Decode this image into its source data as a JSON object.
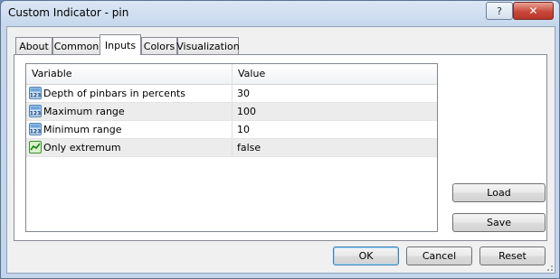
{
  "window": {
    "title": "Custom Indicator - pin",
    "help_label": "?",
    "close_label": "✕"
  },
  "tabs": [
    {
      "label": "About"
    },
    {
      "label": "Common"
    },
    {
      "label": "Inputs",
      "active": true
    },
    {
      "label": "Colors"
    },
    {
      "label": "Visualization"
    }
  ],
  "grid": {
    "headers": {
      "variable": "Variable",
      "value": "Value"
    },
    "rows": [
      {
        "icon": "numeric-123-icon",
        "variable": "Depth of pinbars in percents",
        "value": "30"
      },
      {
        "icon": "numeric-123-icon",
        "variable": "Maximum range",
        "value": "100"
      },
      {
        "icon": "numeric-123-icon",
        "variable": "Minimum range",
        "value": "10"
      },
      {
        "icon": "boolean-chart-icon",
        "variable": "Only extremum",
        "value": "false"
      }
    ]
  },
  "side_buttons": {
    "load": "Load",
    "save": "Save"
  },
  "footer": {
    "ok": "OK",
    "cancel": "Cancel",
    "reset": "Reset"
  }
}
